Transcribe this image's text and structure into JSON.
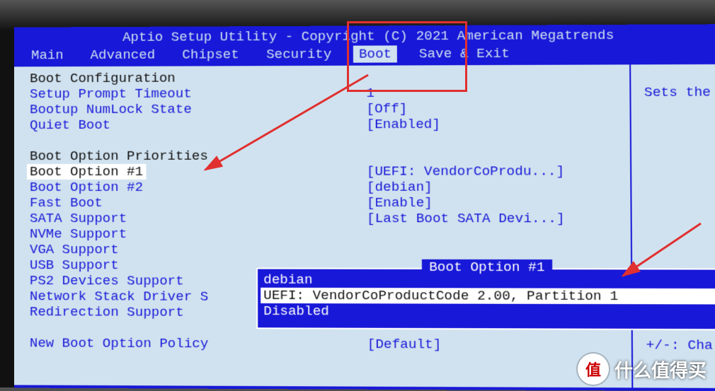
{
  "title": "Aptio Setup Utility - Copyright (C) 2021 American Megatrends",
  "tabs": [
    "Main",
    "Advanced",
    "Chipset",
    "Security",
    "Boot",
    "Save & Exit"
  ],
  "active_tab": "Boot",
  "sections": {
    "boot_config_header": "Boot Configuration",
    "boot_priorities_header": "Boot Option Priorities"
  },
  "items": {
    "setup_prompt_timeout": {
      "label": "Setup Prompt Timeout",
      "value": "1"
    },
    "bootup_numlock": {
      "label": "Bootup NumLock State",
      "value": "[Off]"
    },
    "quiet_boot": {
      "label": "Quiet Boot",
      "value": "[Enabled]"
    },
    "boot_opt_1": {
      "label": "Boot Option #1",
      "value": "[UEFI: VendorCoProdu...]"
    },
    "boot_opt_2": {
      "label": "Boot Option #2",
      "value": "[debian]"
    },
    "fast_boot": {
      "label": "Fast Boot",
      "value": "[Enable]"
    },
    "sata_support": {
      "label": "SATA Support",
      "value": "[Last Boot SATA Devi...]"
    },
    "nvme_support": {
      "label": "NVMe Support",
      "value": ""
    },
    "vga_support": {
      "label": "VGA Support",
      "value": ""
    },
    "usb_support": {
      "label": "USB Support",
      "value": ""
    },
    "ps2_support": {
      "label": "PS2 Devices Support",
      "value": ""
    },
    "net_stack_support": {
      "label": "Network Stack Driver S",
      "value": ""
    },
    "redirection_support": {
      "label": "Redirection Support",
      "value": ""
    },
    "new_boot_policy": {
      "label": "New Boot Option Policy",
      "value": "[Default]"
    }
  },
  "help_text": "Sets the s",
  "help_hint": "+/-: Cha",
  "popup": {
    "title": "Boot Option #1",
    "options": [
      "debian",
      "UEFI: VendorCoProductCode 2.00, Partition 1",
      "Disabled"
    ],
    "selected_index": 1
  },
  "watermark": {
    "badge": "值",
    "text": "什么值得买"
  }
}
